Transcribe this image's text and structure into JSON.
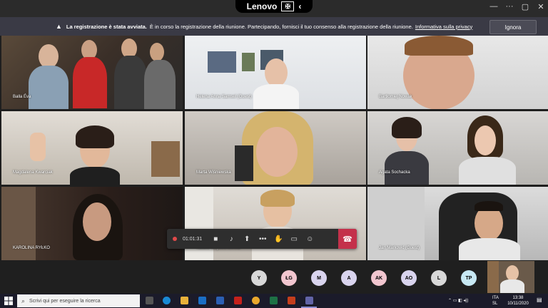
{
  "window": {
    "brand": "Lenovo",
    "brand_badge": "✠",
    "back_glyph": "‹"
  },
  "window_controls": {
    "more": "···",
    "minimize": "—",
    "maximize": "▢",
    "close": "✕"
  },
  "banner": {
    "title": "La registrazione è stata avviata.",
    "text": "È in corso la registrazione della riunione. Partecipando, fornisci il tuo consenso alla registrazione della riunione.",
    "link": "Informativa sulla privacy",
    "dismiss": "Ignora"
  },
  "participants": [
    {
      "name": "Balla Éva"
    },
    {
      "name": "Helena Anna Samsel (Guest)"
    },
    {
      "name": "Bartłomiej Nowak"
    },
    {
      "name": "Magdalena Kwarciak"
    },
    {
      "name": "Marta Wiśniewska"
    },
    {
      "name": "Agata Sochacka"
    },
    {
      "name": "KAROLINA RYŁKO"
    },
    {
      "name": "Natalia Wojciechowska"
    },
    {
      "name": "Jan Marković (Guest)"
    }
  ],
  "toolbar": {
    "timer": "01:01:31"
  },
  "avatars": [
    {
      "initials": "Y",
      "color": "#d8d8d8"
    },
    {
      "initials": "ŁG",
      "color": "#f2c6cf"
    },
    {
      "initials": "M",
      "color": "#d9d4ee"
    },
    {
      "initials": "A",
      "color": "#d9d4ee"
    },
    {
      "initials": "AK",
      "color": "#f2c6cf"
    },
    {
      "initials": "AO",
      "color": "#d9d4ee"
    },
    {
      "initials": "L",
      "color": "#d8d8d8"
    },
    {
      "initials": "TP",
      "color": "#c7e8f3"
    }
  ],
  "taskbar": {
    "search_placeholder": "Scrivi qui per eseguire la ricerca",
    "lang_top": "ITA",
    "lang_bottom": "SL",
    "time": "13:38",
    "date": "10/11/2020"
  },
  "colors": {
    "hangup": "#c4314b",
    "banner_bg": "#3a3a45",
    "accent": "#6264a7"
  }
}
